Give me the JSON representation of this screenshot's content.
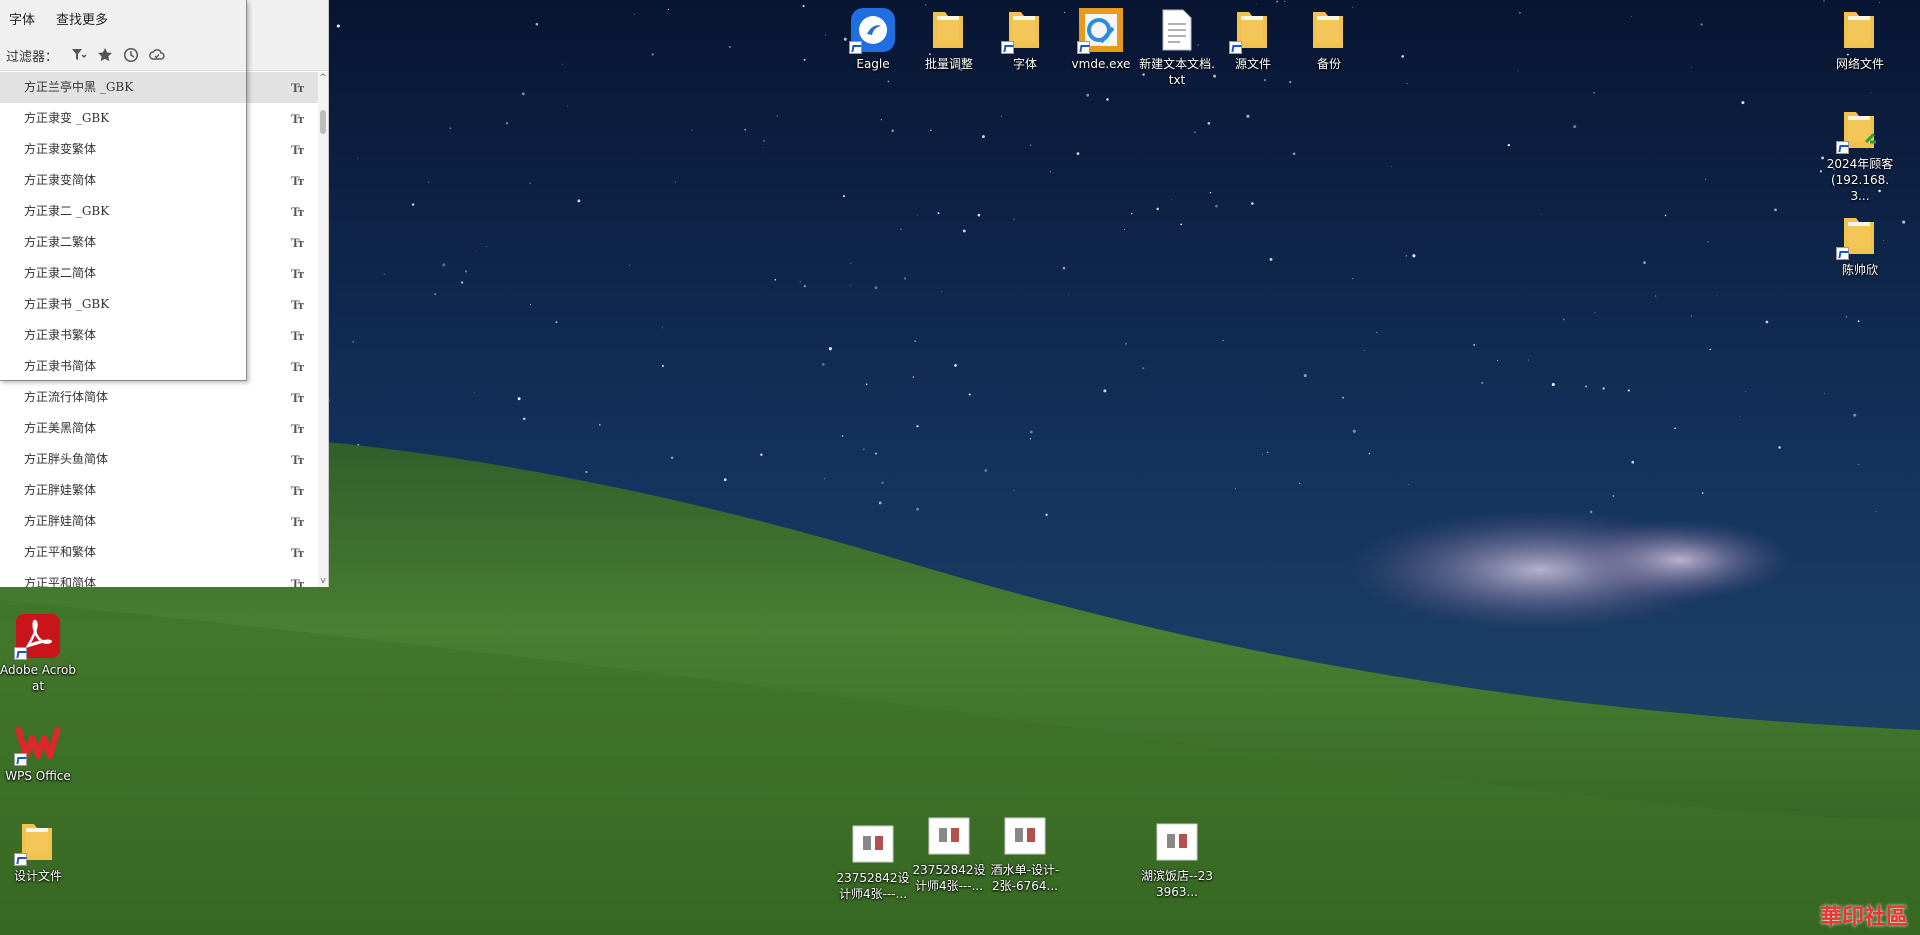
{
  "font_panel": {
    "tabs": [
      "字体",
      "查找更多"
    ],
    "filter_label": "过滤器：",
    "filter_icons": [
      "filter-dropdown-icon",
      "star-icon",
      "clock-icon",
      "cloud-icon"
    ],
    "fonts": [
      "方正兰亭中黑 _GBK",
      "方正隶变 _GBK",
      "方正隶变繁体",
      "方正隶变简体",
      "方正隶二 _GBK",
      "方正隶二繁体",
      "方正隶二简体",
      "方正隶书 _GBK",
      "方正隶书繁体",
      "方正隶书简体",
      "方正流行体简体",
      "方正美黑简体",
      "方正胖头鱼简体",
      "方正胖娃繁体",
      "方正胖娃简体",
      "方正平和繁体",
      "方正平和简体"
    ],
    "selected_index": 0,
    "font_type_icon": "Tт"
  },
  "desktop_icons_top": [
    {
      "label": "Eagle",
      "icon": "eagle-app-icon"
    },
    {
      "label": "批量调整",
      "icon": "folder-icon"
    },
    {
      "label": "字体",
      "icon": "folder-icon"
    },
    {
      "label": "vmde.exe",
      "icon": "vmde-app-icon"
    },
    {
      "label": "新建文本文档.txt",
      "icon": "text-file-icon"
    },
    {
      "label": "源文件",
      "icon": "folder-icon"
    },
    {
      "label": "备份",
      "icon": "folder-icon"
    }
  ],
  "desktop_icons_right": [
    {
      "label": "网络文件",
      "icon": "folder-icon"
    },
    {
      "label": "2024年顾客 (192.168.3...",
      "icon": "network-folder-icon"
    },
    {
      "label": "陈帅欣",
      "icon": "folder-icon"
    }
  ],
  "desktop_icons_left": [
    {
      "label": "Adobe Acrobat",
      "icon": "acrobat-icon"
    },
    {
      "label": "WPS Office",
      "icon": "wps-icon"
    },
    {
      "label": "设计文件",
      "icon": "folder-icon"
    }
  ],
  "desktop_icons_bottom": [
    {
      "label": "23752842设计师4张---...",
      "icon": "image-thumbnail-icon"
    },
    {
      "label": "23752842设计师4张---...",
      "icon": "image-thumbnail-icon"
    },
    {
      "label": "酒水单-设计-2张-6764...",
      "icon": "image-thumbnail-icon"
    },
    {
      "label": "湖滨饭店--233963...",
      "icon": "image-thumbnail-icon"
    }
  ],
  "watermark": "華印社區",
  "colors": {
    "folder": "#f2c14e",
    "sky_top": "#0a1838",
    "grass": "#3f7a2a"
  }
}
